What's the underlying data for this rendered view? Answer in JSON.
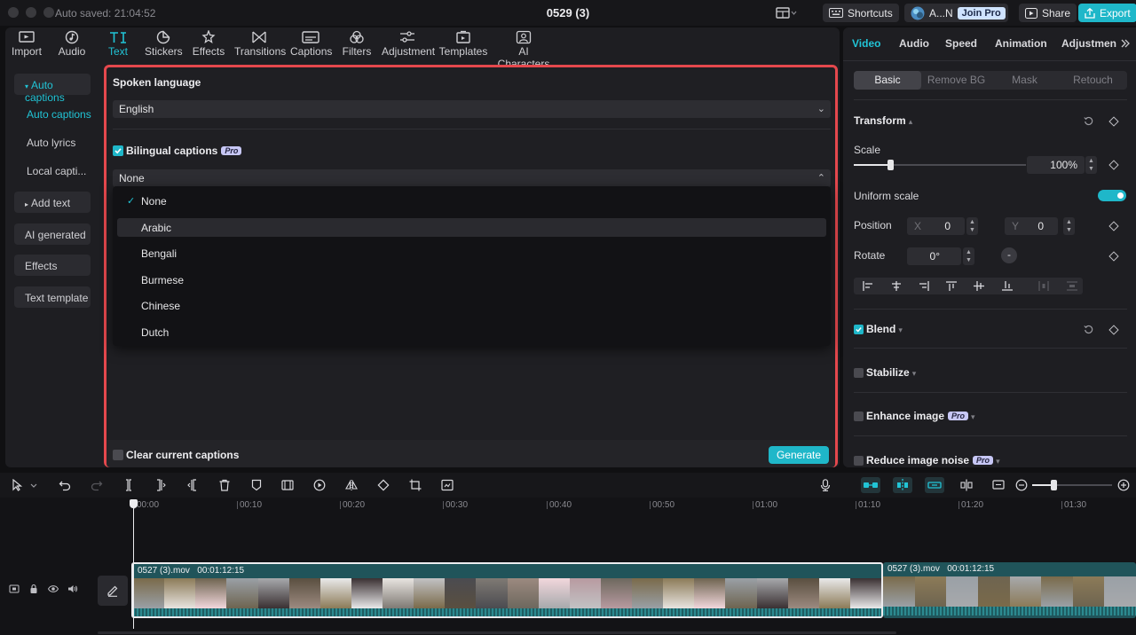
{
  "titlebar": {
    "autosave": "Auto saved: 21:04:52",
    "project_title": "0529 (3)",
    "shortcuts_label": "Shortcuts",
    "account_label": "A...N",
    "join_pro_label": "Join Pro",
    "share_label": "Share",
    "export_label": "Export"
  },
  "toolbar": {
    "items": [
      {
        "label": "Import",
        "icon": "import-icon"
      },
      {
        "label": "Audio",
        "icon": "audio-icon"
      },
      {
        "label": "Text",
        "icon": "text-icon"
      },
      {
        "label": "Stickers",
        "icon": "stickers-icon"
      },
      {
        "label": "Effects",
        "icon": "effects-icon"
      },
      {
        "label": "Transitions",
        "icon": "transitions-icon"
      },
      {
        "label": "Captions",
        "icon": "captions-icon"
      },
      {
        "label": "Filters",
        "icon": "filters-icon"
      },
      {
        "label": "Adjustment",
        "icon": "adjustment-icon"
      },
      {
        "label": "Templates",
        "icon": "templates-icon"
      },
      {
        "label": "AI Characters",
        "icon": "ai-characters-icon"
      }
    ],
    "active": "Text"
  },
  "subnav": {
    "auto_captions_group": "Auto captions",
    "auto_captions": "Auto captions",
    "auto_lyrics": "Auto lyrics",
    "local_captions": "Local capti...",
    "add_text": "Add text",
    "ai_generated": "AI generated",
    "effects": "Effects",
    "text_template": "Text template"
  },
  "captions": {
    "spoken_language_label": "Spoken language",
    "spoken_language_value": "English",
    "bilingual_label": "Bilingual captions",
    "bilingual_checked": true,
    "pro_badge": "Pro",
    "bilingual_value": "None",
    "options": [
      "None",
      "Arabic",
      "Bengali",
      "Burmese",
      "Chinese",
      "Dutch"
    ],
    "selected_option": "None",
    "hovered_option": "Arabic",
    "clear_label": "Clear current captions",
    "generate_label": "Generate"
  },
  "inspector": {
    "tabs": [
      "Video",
      "Audio",
      "Speed",
      "Animation",
      "Adjustmen"
    ],
    "active_tab": "Video",
    "segments": [
      "Basic",
      "Remove BG",
      "Mask",
      "Retouch"
    ],
    "active_segment": "Basic",
    "transform_label": "Transform",
    "scale_label": "Scale",
    "scale_value": "100%",
    "scale_fraction": 0.21,
    "uniform_scale_label": "Uniform scale",
    "uniform_scale_on": true,
    "position_label": "Position",
    "x_label": "X",
    "x_value": "0",
    "y_label": "Y",
    "y_value": "0",
    "rotate_label": "Rotate",
    "rotate_value": "0°",
    "blend_label": "Blend",
    "stabilize_label": "Stabilize",
    "enhance_label": "Enhance image",
    "noise_label": "Reduce image noise",
    "pro_badge": "Pro"
  },
  "timeline": {
    "ticks": [
      "00:00",
      "00:10",
      "00:20",
      "00:30",
      "00:40",
      "00:50",
      "01:00",
      "01:10",
      "01:20",
      "01:30"
    ],
    "clips": [
      {
        "name": "0527 (3).mov",
        "duration": "00:01:12:15"
      },
      {
        "name": "0527 (3).mov",
        "duration": "00:01:12:15"
      }
    ]
  },
  "colors": {
    "accent": "#1fb7c9",
    "highlight_outline": "#e5484d",
    "clip": "#20545a"
  }
}
